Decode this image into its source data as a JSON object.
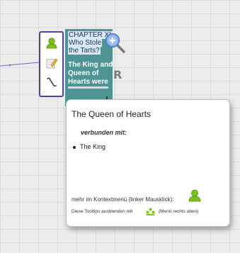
{
  "node_card": {
    "title_lines": [
      "CHAPTER XI.",
      "Who Stole",
      "the Tarts?"
    ],
    "body_lines": [
      "The King and",
      "Queen of",
      "Hearts were"
    ]
  },
  "toolbar": {
    "icons": [
      "user-icon",
      "edit-icon",
      "link-icon"
    ]
  },
  "node_marks": {
    "zoom_icon": "zoom-in-icon",
    "r_label": "R"
  },
  "tooltip": {
    "title": "The Queen of Hearts",
    "connected_label": "verbunden mit:",
    "connections": [
      "The King"
    ],
    "context_menu_text": "mehr im Kontextmenü (linker Mausklick):",
    "hide_text": "Diese Tooltips ausblenden mit",
    "hide_suffix": "(Menü rechts oben)"
  },
  "colors": {
    "toolbar_border": "#5a3ea8",
    "node_fill": "#4f9494",
    "title_highlight": "#d8e8f6",
    "icon_green": "#7cc21c"
  }
}
